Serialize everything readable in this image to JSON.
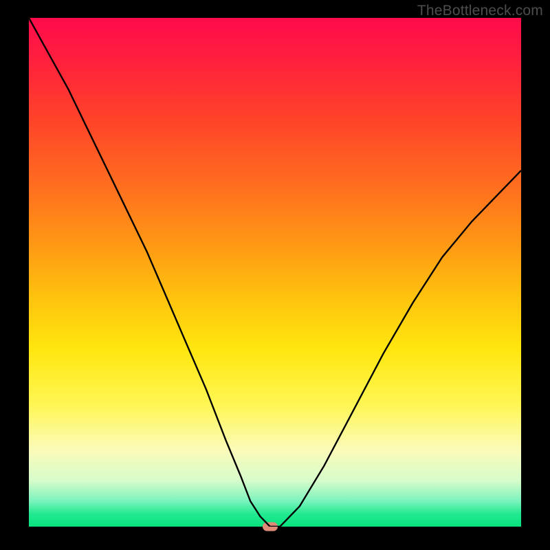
{
  "watermark": "TheBottleneck.com",
  "colors": {
    "frame": "#000000",
    "curve": "#000000",
    "marker": "#df8b78",
    "gradient_stops": [
      "#ff0b4b",
      "#ff1f3e",
      "#ff4329",
      "#ff6e1f",
      "#ff9a14",
      "#ffc30e",
      "#ffe60e",
      "#fff654",
      "#fbfbba",
      "#d6fccb",
      "#7af3bc",
      "#22e990",
      "#08e27f"
    ]
  },
  "chart_data": {
    "type": "line",
    "title": "",
    "xlabel": "",
    "ylabel": "",
    "xlim": [
      0,
      100
    ],
    "ylim": [
      0,
      100
    ],
    "grid": false,
    "legend": false,
    "annotations": [],
    "x": [
      0,
      4,
      8,
      12,
      16,
      20,
      24,
      28,
      32,
      36,
      40,
      43,
      45,
      47,
      49,
      51,
      55,
      60,
      66,
      72,
      78,
      84,
      90,
      96,
      100
    ],
    "values": [
      100,
      93,
      86,
      78,
      70,
      62,
      54,
      45,
      36,
      27,
      17,
      10,
      5,
      2,
      0,
      0,
      4,
      12,
      23,
      34,
      44,
      53,
      60,
      66,
      70
    ],
    "marker": {
      "x": 49,
      "y": 0
    }
  }
}
